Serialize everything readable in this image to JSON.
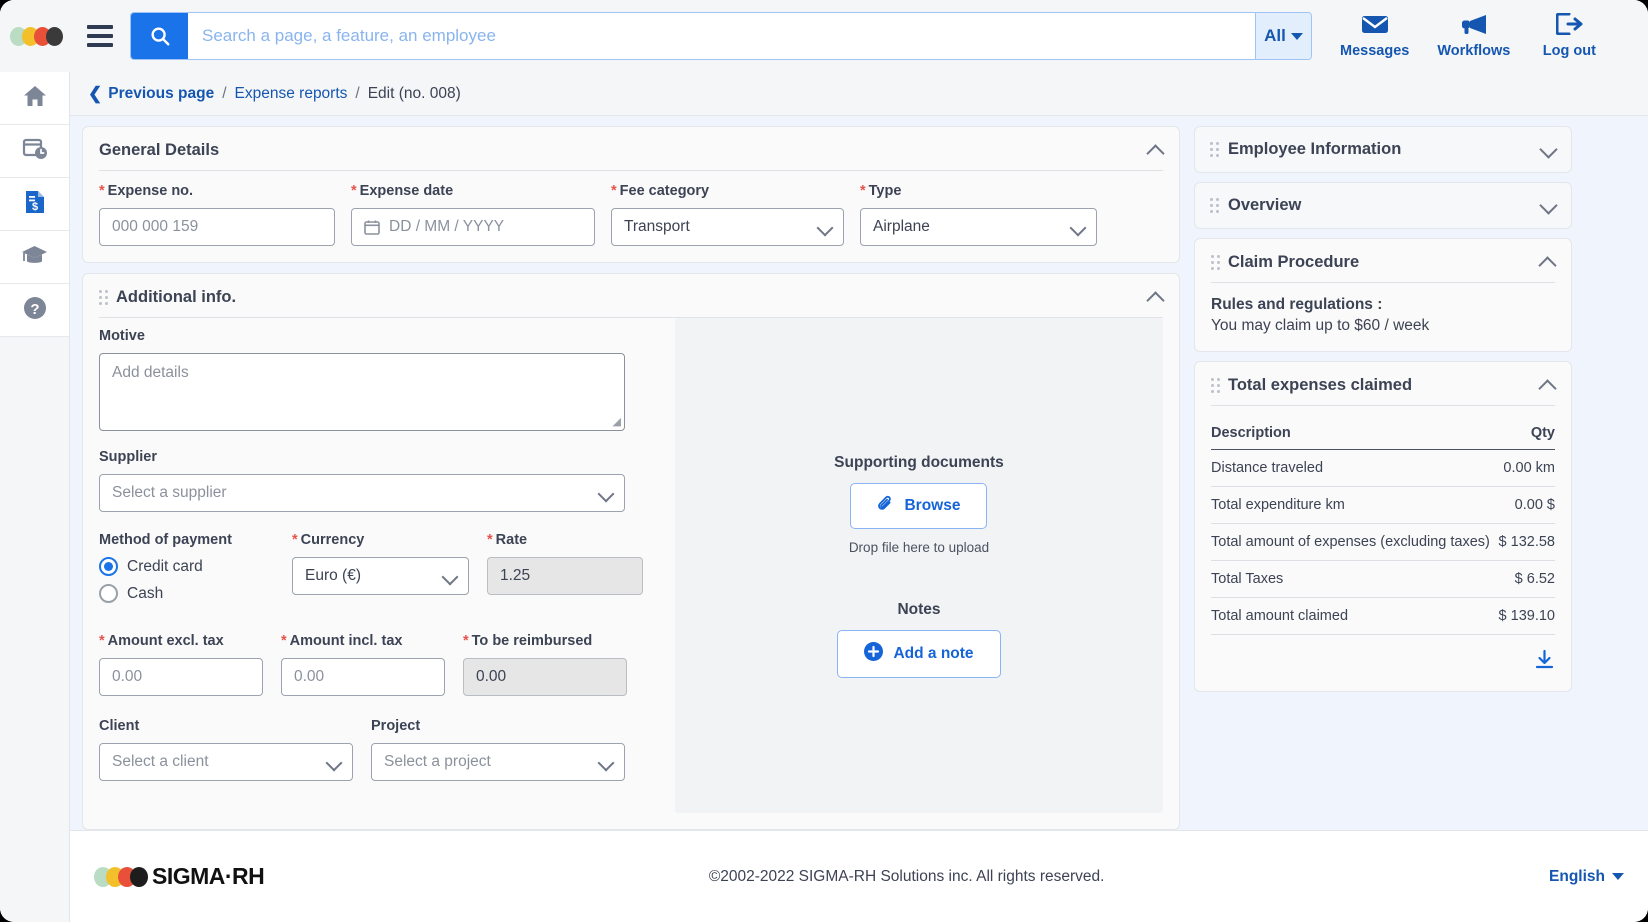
{
  "colors": {
    "primary": "#1a73e8",
    "link": "#1557b0",
    "required": "#e5534b",
    "page_bg": "#eff4fd"
  },
  "topbar": {
    "search_placeholder": "Search a page, a feature, an employee",
    "search_value": "",
    "search_icon": "search-icon",
    "menu_icon": "hamburger-icon",
    "scope_label": "All",
    "actions": [
      {
        "label": "Messages",
        "icon": "envelope-icon"
      },
      {
        "label": "Workflows",
        "icon": "megaphone-icon"
      },
      {
        "label": "Log out",
        "icon": "logout-icon"
      }
    ]
  },
  "rail": {
    "items": [
      {
        "icon": "home-icon",
        "name": "home",
        "active": false
      },
      {
        "icon": "calendar-clock-icon",
        "name": "time",
        "active": false
      },
      {
        "icon": "expense-document-icon",
        "name": "expenses",
        "active": true
      },
      {
        "icon": "graduation-cap-icon",
        "name": "training",
        "active": false
      },
      {
        "icon": "help-circle-icon",
        "name": "help",
        "active": false
      }
    ]
  },
  "breadcrumb": {
    "previous": "Previous page",
    "section": "Expense reports",
    "current": "Edit (no. 008)",
    "separator": "/"
  },
  "general_details": {
    "title": "General Details",
    "fields": {
      "expense_no": {
        "label": "Expense no.",
        "required": true,
        "placeholder": "000 000 159",
        "value": ""
      },
      "expense_date": {
        "label": "Expense date",
        "required": true,
        "placeholder": "DD / MM / YYYY",
        "value": "",
        "icon": "calendar-icon"
      },
      "fee_category": {
        "label": "Fee category",
        "required": true,
        "value": "Transport"
      },
      "type": {
        "label": "Type",
        "required": true,
        "value": "Airplane"
      }
    }
  },
  "additional_info": {
    "title": "Additional info.",
    "motive": {
      "label": "Motive",
      "placeholder": "Add details",
      "value": ""
    },
    "supplier": {
      "label": "Supplier",
      "placeholder": "Select a supplier",
      "value": ""
    },
    "method_of_payment": {
      "label": "Method of payment",
      "options": [
        {
          "label": "Credit card",
          "selected": true
        },
        {
          "label": "Cash",
          "selected": false
        }
      ]
    },
    "currency": {
      "label": "Currency",
      "required": true,
      "value": "Euro (€)"
    },
    "rate": {
      "label": "Rate",
      "required": true,
      "value": "1.25",
      "disabled": true
    },
    "amount_excl_tax": {
      "label": "Amount excl. tax",
      "required": true,
      "placeholder": "0.00",
      "value": ""
    },
    "amount_incl_tax": {
      "label": "Amount incl. tax",
      "required": true,
      "placeholder": "0.00",
      "value": ""
    },
    "to_be_reimbursed": {
      "label": "To be reimbursed",
      "required": true,
      "value": "0.00",
      "disabled": true
    },
    "client": {
      "label": "Client",
      "placeholder": "Select a client",
      "value": ""
    },
    "project": {
      "label": "Project",
      "placeholder": "Select a project",
      "value": ""
    },
    "supporting_documents": {
      "title": "Supporting documents",
      "browse_label": "Browse",
      "browse_icon": "paperclip-icon",
      "drop_hint": "Drop file here to upload"
    },
    "notes": {
      "title": "Notes",
      "add_label": "Add a note",
      "add_icon": "plus-circle-icon"
    }
  },
  "side_panels": {
    "employee_information": {
      "title": "Employee Information",
      "expanded": false
    },
    "overview": {
      "title": "Overview",
      "expanded": false
    },
    "claim_procedure": {
      "title": "Claim Procedure",
      "expanded": true,
      "rules_title": "Rules and regulations :",
      "rules_text": "You may claim up to $60 / week"
    },
    "total_expenses": {
      "title": "Total expenses claimed",
      "expanded": true,
      "columns": [
        "Description",
        "Qty"
      ],
      "rows": [
        {
          "description": "Distance traveled",
          "qty": "0.00 km"
        },
        {
          "description": "Total expenditure km",
          "qty": "0.00 $"
        },
        {
          "description": "Total amount of expenses (excluding taxes)",
          "qty": "$ 132.58"
        },
        {
          "description": "Total Taxes",
          "qty": "$ 6.52"
        },
        {
          "description": "Total amount claimed",
          "qty": "$ 139.10"
        }
      ],
      "download_icon": "download-icon"
    }
  },
  "footer": {
    "brand": "SIGMA·RH",
    "copyright": "©2002-2022 SIGMA-RH Solutions inc. All rights reserved.",
    "language": "English"
  }
}
